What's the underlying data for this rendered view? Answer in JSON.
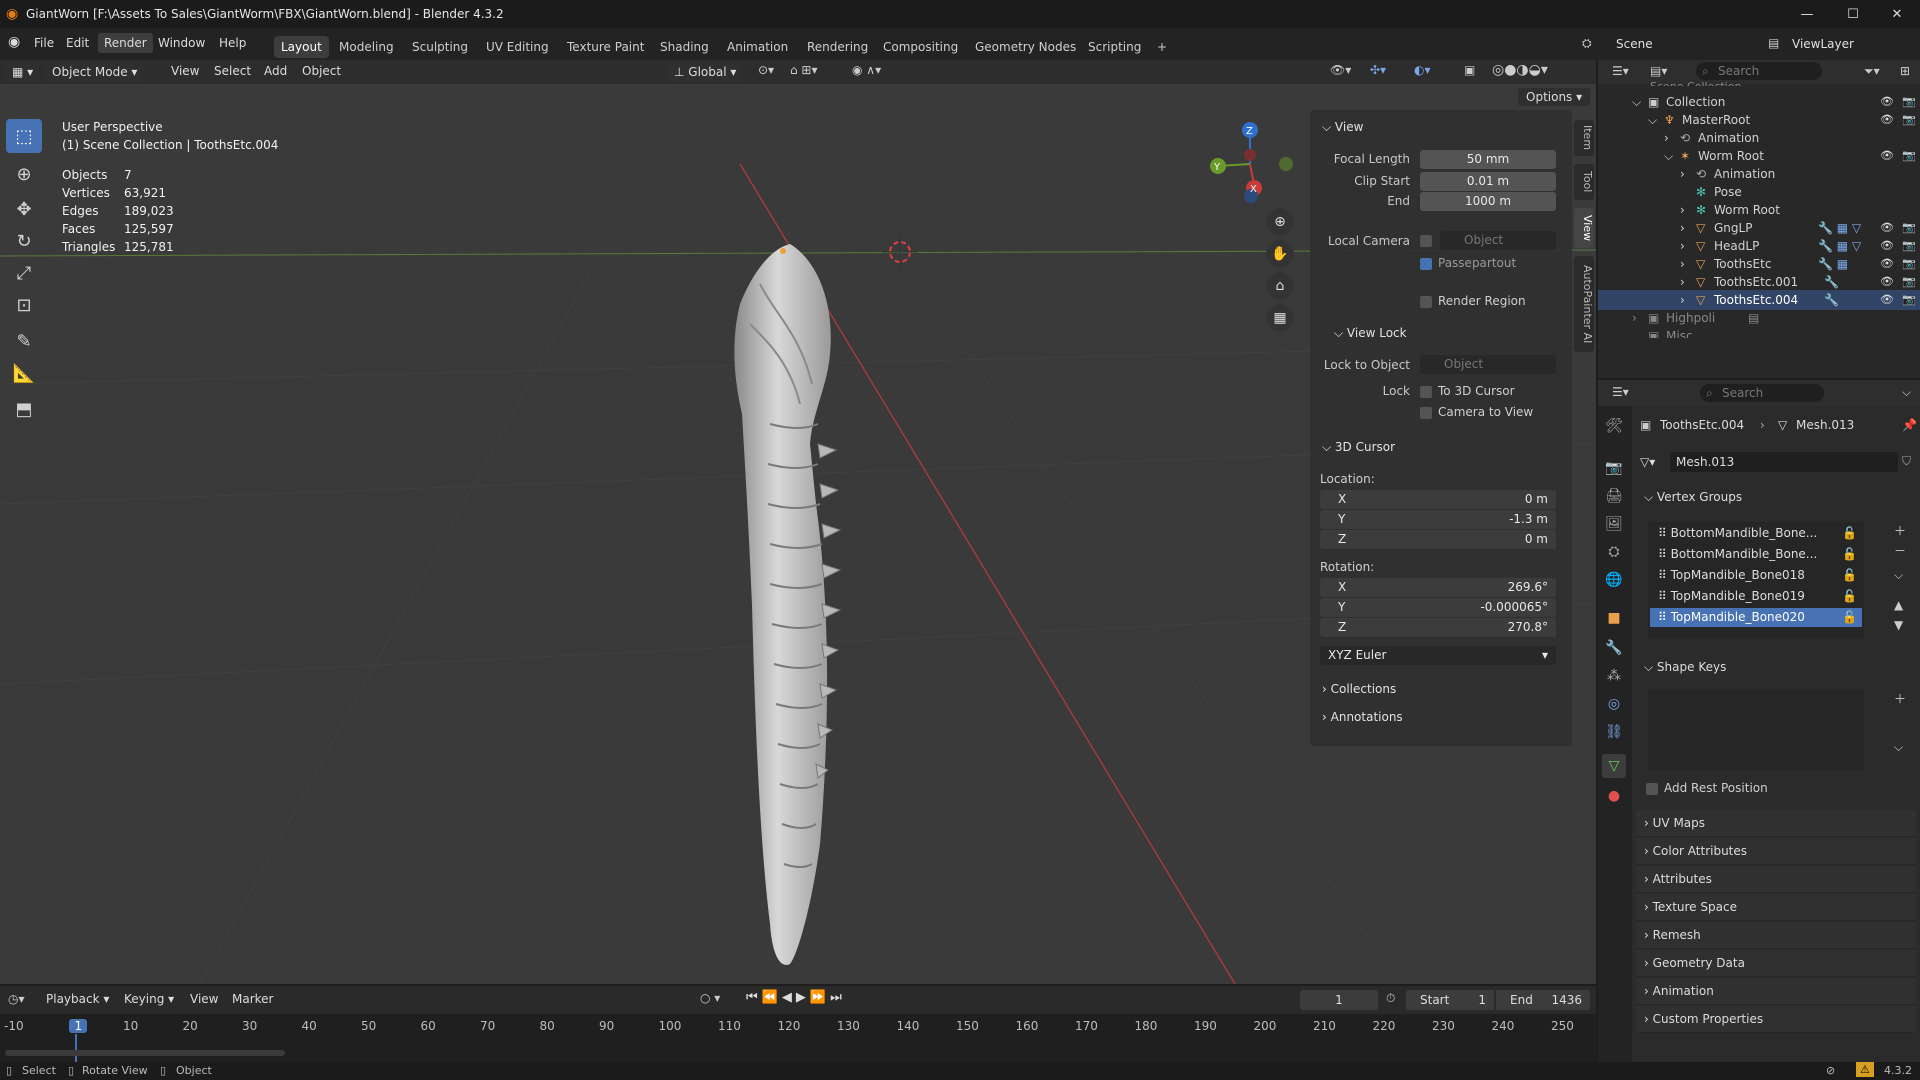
{
  "window": {
    "title": "GiantWorn [F:\\Assets To Sales\\GiantWorm\\FBX\\GiantWorn.blend] - Blender 4.3.2",
    "minimize": "—",
    "maximize": "☐",
    "close": "✕"
  },
  "menus": [
    "File",
    "Edit",
    "Render",
    "Window",
    "Help"
  ],
  "workspaces": [
    "Layout",
    "Modeling",
    "Sculpting",
    "UV Editing",
    "Texture Paint",
    "Shading",
    "Animation",
    "Rendering",
    "Compositing",
    "Geometry Nodes",
    "Scripting",
    "+"
  ],
  "scene": {
    "label": "Scene",
    "view_layer": "ViewLayer"
  },
  "viewport_header": {
    "mode": "Object Mode",
    "view": "View",
    "select": "Select",
    "add": "Add",
    "object": "Object",
    "orientation": "Global",
    "options": "Options"
  },
  "viewport": {
    "perspective": "User Perspective",
    "collection_path": "(1) Scene Collection | ToothsEtc.004",
    "stats": [
      {
        "label": "Objects",
        "value": "7"
      },
      {
        "label": "Vertices",
        "value": "63,921"
      },
      {
        "label": "Edges",
        "value": "189,023"
      },
      {
        "label": "Faces",
        "value": "125,597"
      },
      {
        "label": "Triangles",
        "value": "125,781"
      }
    ],
    "gizmo": {
      "x": "X",
      "y": "Y",
      "z": "Z"
    }
  },
  "npanel": {
    "tabs": [
      "Item",
      "Tool",
      "View",
      "AutoPainter AI"
    ],
    "view_title": "View",
    "focal_length_label": "Focal Length",
    "focal_length": "50 mm",
    "clip_start_label": "Clip Start",
    "clip_start": "0.01 m",
    "end_label": "End",
    "end": "1000 m",
    "local_camera_label": "Local Camera",
    "object_placeholder": "Object",
    "passepartout": "Passepartout",
    "render_region": "Render Region",
    "view_lock_title": "View Lock",
    "lock_to_object_label": "Lock to Object",
    "lock_label": "Lock",
    "to_3d_cursor": "To 3D Cursor",
    "camera_to_view": "Camera to View",
    "cursor_title": "3D Cursor",
    "location_label": "Location:",
    "loc_x": "0 m",
    "loc_y": "-1.3 m",
    "loc_z": "0 m",
    "rotation_label": "Rotation:",
    "rot_x": "269.6°",
    "rot_y": "-0.000065°",
    "rot_z": "270.8°",
    "axis_x": "X",
    "axis_y": "Y",
    "axis_z": "Z",
    "rotation_mode": "XYZ Euler",
    "collections": "Collections",
    "annotations": "Annotations"
  },
  "outliner": {
    "search_placeholder": "Search",
    "top_partial": "Scene Collection",
    "rows": [
      {
        "name": "Collection",
        "indent": 0
      },
      {
        "name": "MasterRoot",
        "indent": 1
      },
      {
        "name": "Animation",
        "indent": 2
      },
      {
        "name": "Worm Root",
        "indent": 2
      },
      {
        "name": "Animation",
        "indent": 3
      },
      {
        "name": "Pose",
        "indent": 3
      },
      {
        "name": "Worm Root",
        "indent": 3
      },
      {
        "name": "GngLP",
        "indent": 3
      },
      {
        "name": "HeadLP",
        "indent": 3
      },
      {
        "name": "ToothsEtc",
        "indent": 3
      },
      {
        "name": "ToothsEtc.001",
        "indent": 3
      },
      {
        "name": "ToothsEtc.004",
        "indent": 3
      },
      {
        "name": "Highpoli",
        "indent": 0
      },
      {
        "name": "Misc",
        "indent": 0
      }
    ]
  },
  "properties": {
    "search_placeholder": "Search",
    "object_name": "ToothsEtc.004",
    "mesh_name": "Mesh.013",
    "vertex_groups_title": "Vertex Groups",
    "vertex_groups": [
      "BottomMandible_Bone...",
      "BottomMandible_Bone...",
      "TopMandible_Bone018",
      "TopMandible_Bone019",
      "TopMandible_Bone020"
    ],
    "shape_keys_title": "Shape Keys",
    "add_rest_position": "Add Rest Position",
    "sections": [
      "UV Maps",
      "Color Attributes",
      "Attributes",
      "Texture Space",
      "Remesh",
      "Geometry Data",
      "Animation",
      "Custom Properties"
    ]
  },
  "timeline": {
    "playback": "Playback",
    "keying": "Keying",
    "view": "View",
    "marker": "Marker",
    "current_frame": "1",
    "start_label": "Start",
    "start": "1",
    "end_label": "End",
    "end": "1436",
    "ticks": [
      "-10",
      "1",
      "10",
      "20",
      "30",
      "40",
      "50",
      "60",
      "70",
      "80",
      "90",
      "100",
      "110",
      "120",
      "130",
      "140",
      "150",
      "160",
      "170",
      "180",
      "190",
      "200",
      "210",
      "220",
      "230",
      "240",
      "250"
    ]
  },
  "statusbar": {
    "select": "Select",
    "rotate_view": "Rotate View",
    "object": "Object",
    "version": "4.3.2"
  },
  "colors": {
    "accent": "#4772b3",
    "viewport_bg": "#3a3a3a",
    "x_axis": "#c93a3a",
    "y_axis": "#6a9a2a",
    "z_axis": "#2f6fd0"
  }
}
